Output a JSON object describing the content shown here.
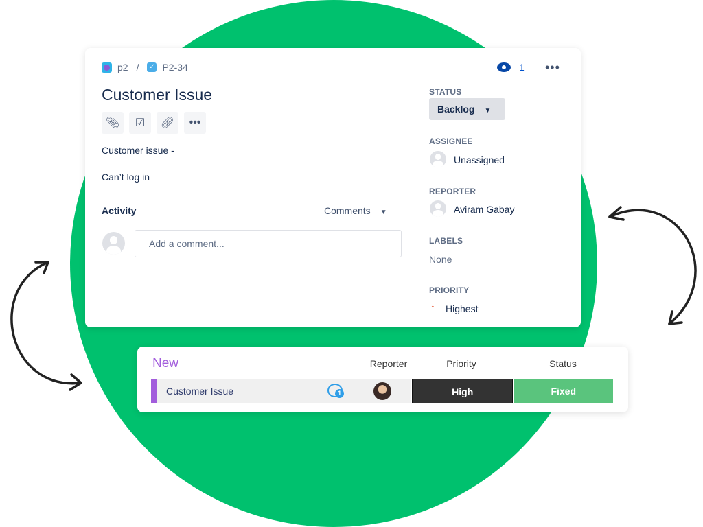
{
  "issue": {
    "breadcrumb": {
      "project": "p2",
      "separator": "/",
      "issue_key": "P2-34"
    },
    "title": "Customer Issue",
    "toolbar": {
      "icons": [
        "paperclip-icon",
        "subtask-icon",
        "link-icon",
        "more-icon"
      ]
    },
    "description": [
      "Customer issue -",
      "Can’t log in"
    ],
    "activity": {
      "label": "Activity",
      "filter": "Comments",
      "comment_placeholder": "Add a comment..."
    },
    "watchers": "1",
    "fields": {
      "status_label": "STATUS",
      "status": "Backlog",
      "assignee_label": "ASSIGNEE",
      "assignee": "Unassigned",
      "reporter_label": "REPORTER",
      "reporter": "Aviram Gabay",
      "labels_label": "LABELS",
      "labels": "None",
      "priority_label": "PRIORITY",
      "priority": "Highest"
    }
  },
  "board": {
    "group": "New",
    "columns": [
      "Reporter",
      "Priority",
      "Status"
    ],
    "row": {
      "name": "Customer Issue",
      "comments": "1",
      "priority": "High",
      "status": "Fixed"
    }
  },
  "colors": {
    "background_circle": "#00c16e",
    "group": "#a25ddc",
    "priority_high": "#333333",
    "status_fixed": "#5ac47d",
    "priority_highest": "#de350b"
  }
}
